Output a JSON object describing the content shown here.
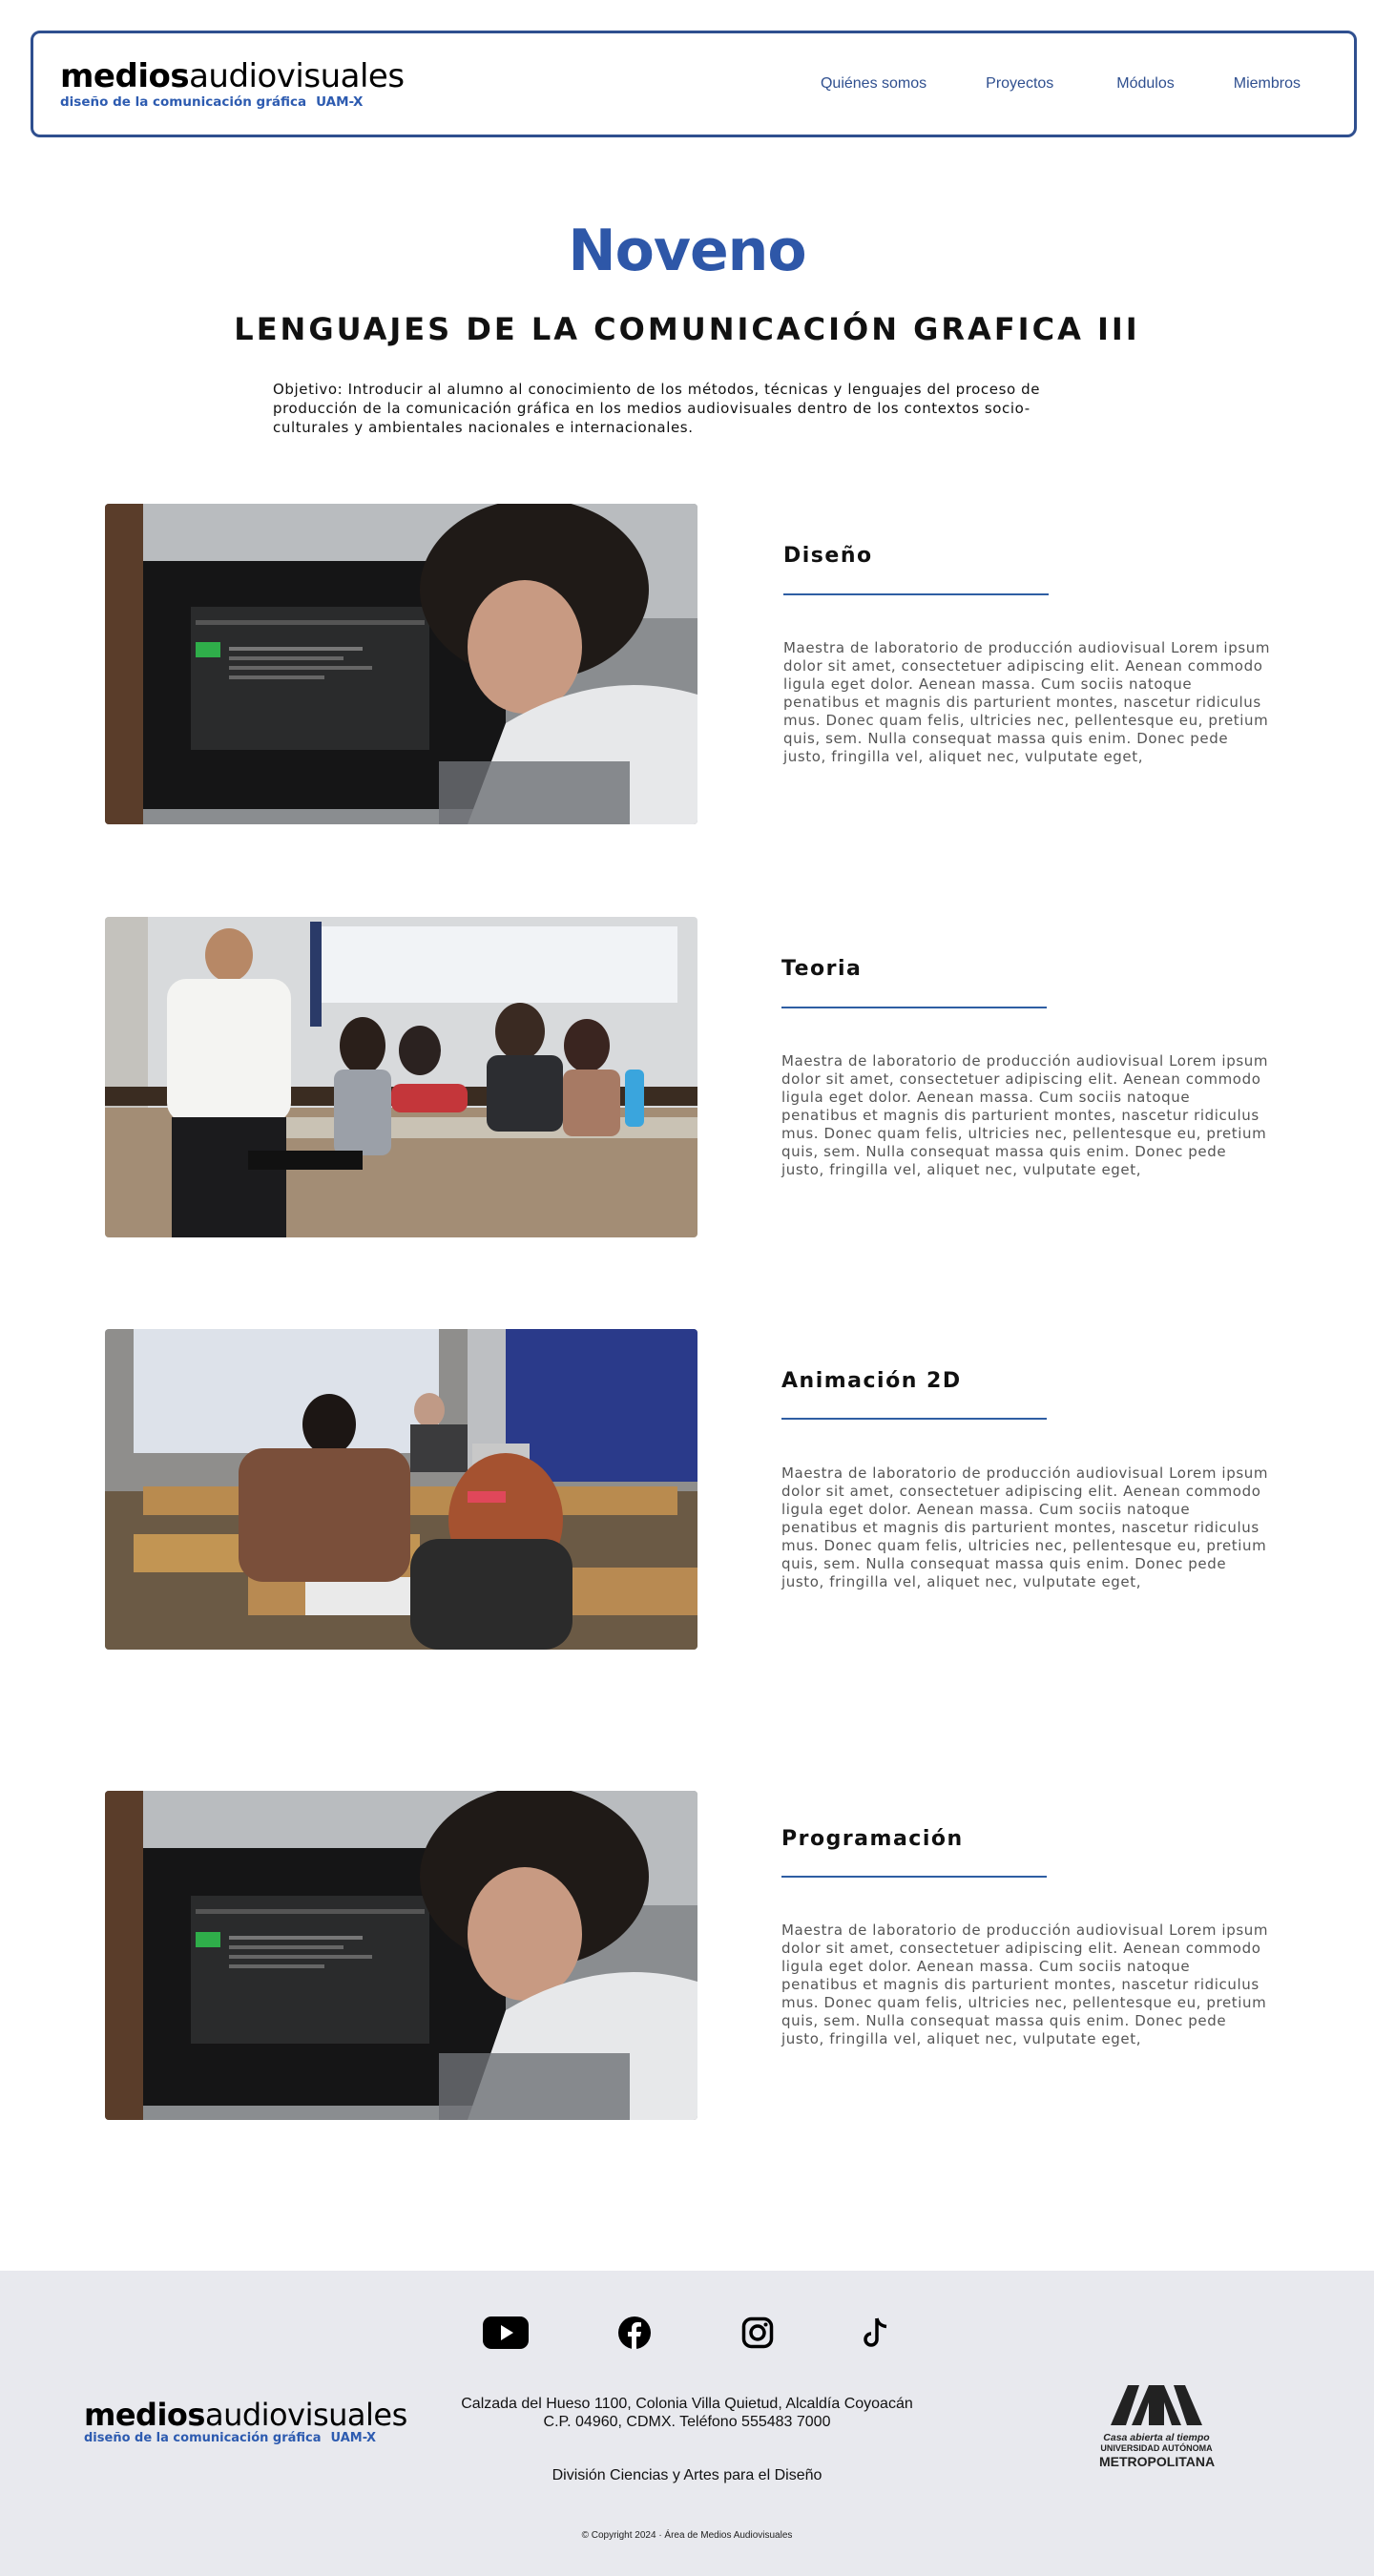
{
  "header": {
    "logo_bold": "medios",
    "logo_regular": "audiovisuales",
    "logo_sub": "diseño de la comunicación gráfica",
    "logo_sub_uam": "UAM-X",
    "nav": [
      "Quiénes somos",
      "Proyectos",
      "Módulos",
      "Miembros"
    ]
  },
  "hero": {
    "title": "Noveno",
    "subtitle": "LENGUAJES DE LA COMUNICACIÓN GRAFICA III",
    "objective": "Objetivo: Introducir al alumno al conocimiento de los métodos, técnicas y lenguajes del proceso de producción de la comunicación gráfica en los medios audiovisuales dentro de los contextos socio-culturales y ambientales nacionales e internacionales."
  },
  "sections": [
    {
      "title": "Diseño",
      "text": "Maestra de laboratorio de producción audiovisual Lorem ipsum dolor sit amet, consectetuer adipiscing elit. Aenean commodo ligula eget dolor. Aenean massa. Cum sociis natoque penatibus et magnis dis parturient montes, nascetur ridiculus mus. Donec quam felis, ultricies nec, pellentesque eu, pretium quis, sem. Nulla consequat massa quis enim. Donec pede justo, fringilla vel, aliquet nec, vulputate eget,"
    },
    {
      "title": "Teoria",
      "text": "Maestra de laboratorio de producción audiovisual Lorem ipsum dolor sit amet, consectetuer adipiscing elit. Aenean commodo ligula eget dolor. Aenean massa. Cum sociis natoque penatibus et magnis dis parturient montes, nascetur ridiculus mus. Donec quam felis, ultricies nec, pellentesque eu, pretium quis, sem. Nulla consequat massa quis enim. Donec pede justo, fringilla vel, aliquet nec, vulputate eget,"
    },
    {
      "title": "Animación 2D",
      "text": "Maestra de laboratorio de producción audiovisual Lorem ipsum dolor sit amet, consectetuer adipiscing elit. Aenean commodo ligula eget dolor. Aenean massa. Cum sociis natoque penatibus et magnis dis parturient montes, nascetur ridiculus mus. Donec quam felis, ultricies nec, pellentesque eu, pretium quis, sem. Nulla consequat massa quis enim. Donec pede justo, fringilla vel, aliquet nec, vulputate eget,"
    },
    {
      "title": "Programación",
      "text": "Maestra de laboratorio de producción audiovisual Lorem ipsum dolor sit amet, consectetuer adipiscing elit. Aenean commodo ligula eget dolor. Aenean massa. Cum sociis natoque penatibus et magnis dis parturient montes, nascetur ridiculus mus. Donec quam felis, ultricies nec, pellentesque eu, pretium quis, sem. Nulla consequat massa quis enim. Donec pede justo, fringilla vel, aliquet nec, vulputate eget,"
    }
  ],
  "footer": {
    "social_icons": [
      "youtube-icon",
      "facebook-icon",
      "instagram-icon",
      "tiktok-icon"
    ],
    "address_line1": "Calzada del Hueso 1100, Colonia Villa Quietud, Alcaldía Coyoacán",
    "address_line2": "C.P. 04960, CDMX. Teléfono 555483 7000",
    "division": "División Ciencias y Artes para el Diseño",
    "copyright": "© Copyright 2024 · Área de Medios Audiovisuales",
    "uam_line1": "Casa abierta al tiempo",
    "uam_line2": "UNIVERSIDAD AUTÓNOMA",
    "uam_line3": "METROPOLITANA"
  },
  "colors": {
    "accent": "#2e57a8",
    "header_border": "#2f4f8f",
    "footer_bg": "#e8e9ee"
  }
}
